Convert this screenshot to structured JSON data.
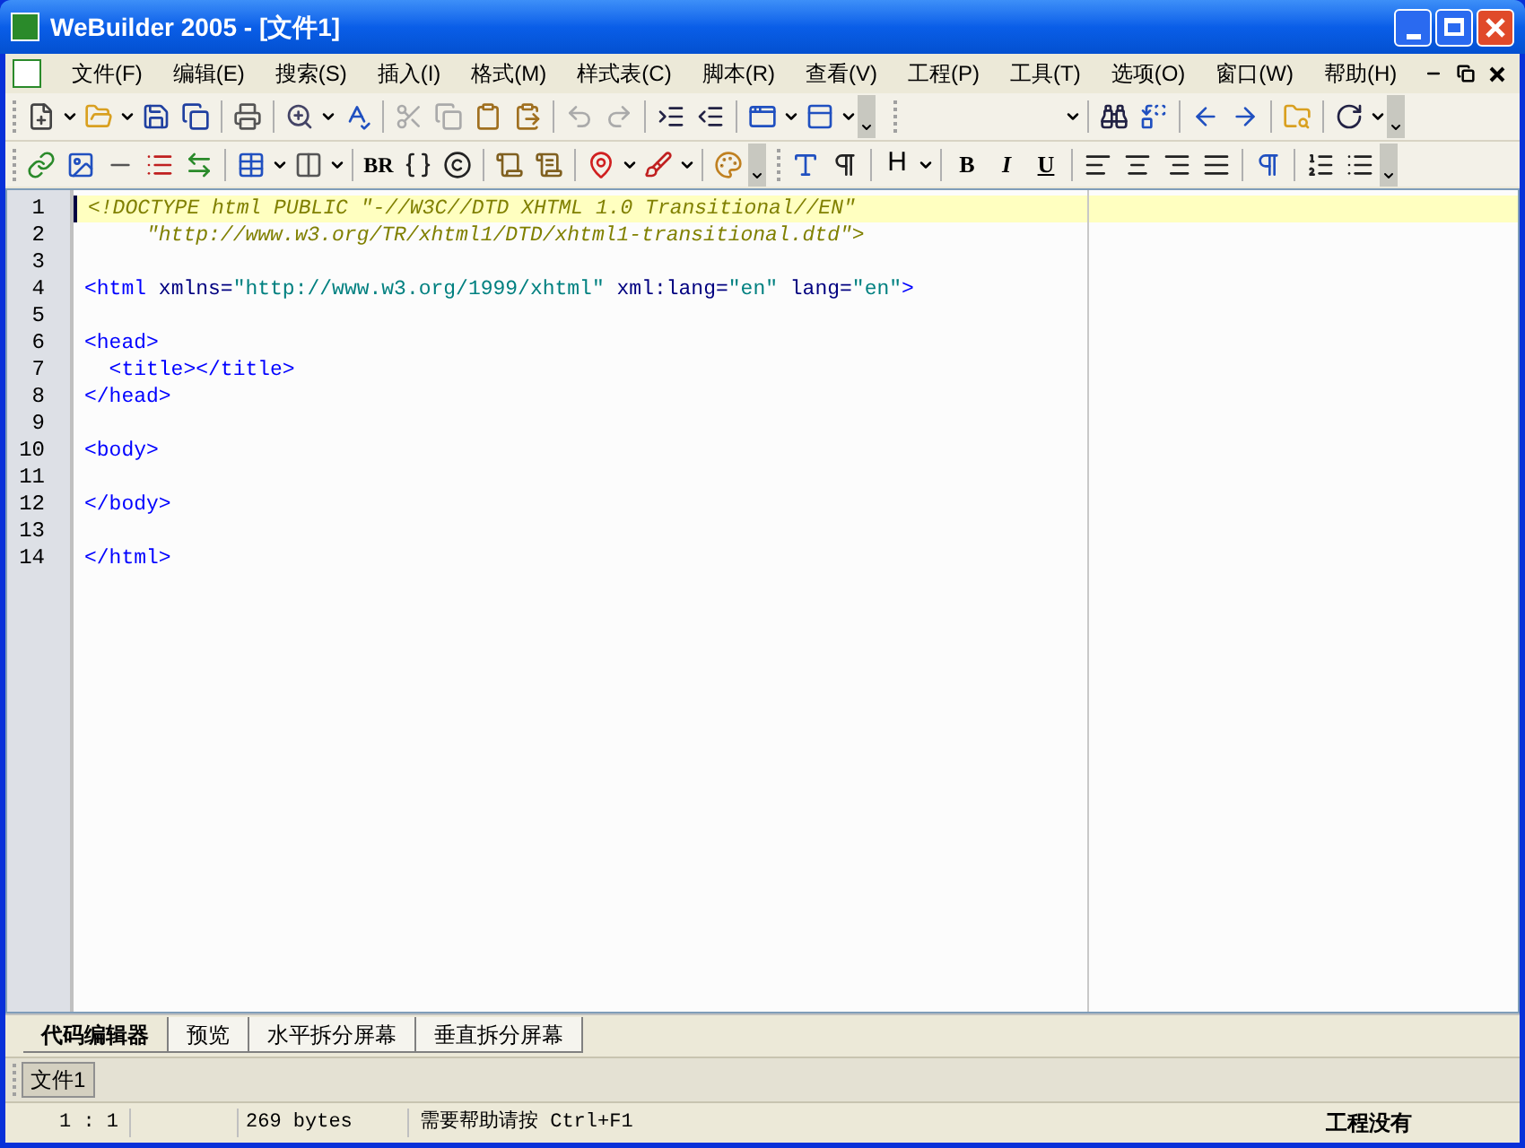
{
  "window": {
    "title": "WeBuilder 2005 - [文件1]"
  },
  "menu": [
    "文件(F)",
    "编辑(E)",
    "搜索(S)",
    "插入(I)",
    "格式(M)",
    "样式表(C)",
    "脚本(R)",
    "查看(V)",
    "工程(P)",
    "工具(T)",
    "选项(O)",
    "窗口(W)",
    "帮助(H)"
  ],
  "toolbar_text": {
    "br": "BR",
    "heading": "H",
    "bold": "B",
    "italic": "I",
    "underline": "U"
  },
  "editor": {
    "lines": [
      {
        "number": "1",
        "selected": true,
        "segments": [
          {
            "kind": "doctype",
            "text": "<!DOCTYPE html PUBLIC \"-//W3C//DTD XHTML 1.0 Transitional//EN\""
          }
        ]
      },
      {
        "number": "2",
        "selected": false,
        "segments": [
          {
            "kind": "doctype",
            "text": "     \"http://www.w3.org/TR/xhtml1/DTD/xhtml1-transitional.dtd\">"
          }
        ]
      },
      {
        "number": "3",
        "selected": false
      },
      {
        "number": "4",
        "selected": false,
        "segments": [
          {
            "kind": "tag",
            "text": "<html"
          },
          {
            "kind": "attr",
            "text": " xmlns="
          },
          {
            "kind": "string",
            "text": "\"http://www.w3.org/1999/xhtml\""
          },
          {
            "kind": "attr",
            "text": " xml:lang="
          },
          {
            "kind": "string",
            "text": "\"en\""
          },
          {
            "kind": "attr",
            "text": " lang="
          },
          {
            "kind": "string",
            "text": "\"en\""
          },
          {
            "kind": "tag",
            "text": ">"
          }
        ]
      },
      {
        "number": "5",
        "selected": false
      },
      {
        "number": "6",
        "selected": false,
        "segments": [
          {
            "kind": "tag",
            "text": "<head>"
          }
        ]
      },
      {
        "number": "7",
        "selected": false,
        "segments": [
          {
            "kind": "tag",
            "text": "  <title></title>"
          }
        ]
      },
      {
        "number": "8",
        "selected": false,
        "segments": [
          {
            "kind": "tag",
            "text": "</head>"
          }
        ]
      },
      {
        "number": "9",
        "selected": false
      },
      {
        "number": "10",
        "selected": false,
        "segments": [
          {
            "kind": "tag",
            "text": "<body>"
          }
        ]
      },
      {
        "number": "11",
        "selected": false
      },
      {
        "number": "12",
        "selected": false,
        "segments": [
          {
            "kind": "tag",
            "text": "</body>"
          }
        ]
      },
      {
        "number": "13",
        "selected": false
      },
      {
        "number": "14",
        "selected": false,
        "segments": [
          {
            "kind": "tag",
            "text": "</html>"
          }
        ]
      }
    ]
  },
  "view_tabs": [
    {
      "label": "代码编辑器",
      "selected": true
    },
    {
      "label": "预览",
      "selected": false
    },
    {
      "label": "水平拆分屏幕",
      "selected": false
    },
    {
      "label": "垂直拆分屏幕",
      "selected": false
    }
  ],
  "documents": [
    {
      "label": "文件1",
      "selected": true
    }
  ],
  "status_bar": {
    "position": "1 : 1",
    "size": "269 bytes",
    "hint": "需要帮助请按 Ctrl+F1",
    "project": "工程没有"
  }
}
